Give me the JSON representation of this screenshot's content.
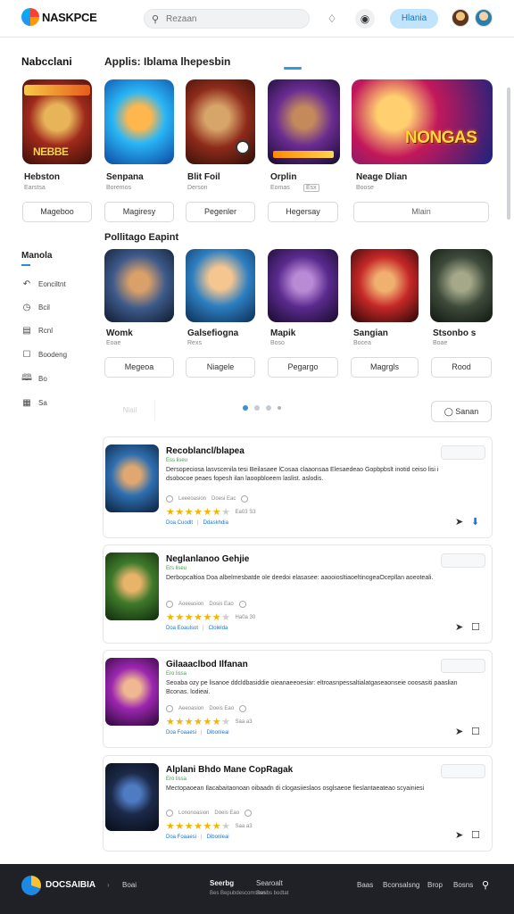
{
  "header": {
    "brand": "NASKPCE",
    "search_placeholder": "Rezaan",
    "cta_label": "Hlania"
  },
  "sidebar": {
    "title": "Nabcclani",
    "subtitle": "Manola",
    "items": [
      {
        "label": "Eonciltnt",
        "icon": "hand-icon"
      },
      {
        "label": "Bcil",
        "icon": "clock-icon"
      },
      {
        "label": "Rcnl",
        "icon": "inbox-icon"
      },
      {
        "label": "Boodeng",
        "icon": "chat-icon"
      },
      {
        "label": "Bo",
        "icon": "book-icon"
      },
      {
        "label": "Sa",
        "icon": "grid-icon"
      }
    ]
  },
  "section1": {
    "title": "Applis: Iblama lhepesbin",
    "tiles": [
      {
        "name": "Hebston",
        "sub": "Earstsa",
        "button": "Mageboo",
        "art": "NEBBE"
      },
      {
        "name": "Senpana",
        "sub": "Boremos",
        "button": "Magiresy",
        "art": ""
      },
      {
        "name": "Blit Foil",
        "sub": "Derson",
        "button": "Pegenler",
        "art": ""
      },
      {
        "name": "Orplin",
        "sub": "Eomas",
        "button": "Hegersay",
        "art": ""
      },
      {
        "name": "Neage Dlian",
        "sub": "Boose",
        "button": "Mlain",
        "art": "NONGAS"
      }
    ],
    "orplin_badge": "Esx"
  },
  "section2": {
    "title": "Pollitago Eapint",
    "tiles": [
      {
        "name": "Womk",
        "sub": "Eoae",
        "button": "Megeoa"
      },
      {
        "name": "Galsefiogna",
        "sub": "Rexs",
        "button": "Niagele"
      },
      {
        "name": "Mapik",
        "sub": "Boso",
        "button": "Pegargo"
      },
      {
        "name": "Sangian",
        "sub": "Bocea",
        "button": "Magrgls"
      },
      {
        "name": "Stsonbo s",
        "sub": "Boae",
        "button": "Rood"
      }
    ]
  },
  "pagination": {
    "ghost_label": "Niail",
    "pages": 4,
    "active": 0,
    "right_button": "Sanan"
  },
  "feed": [
    {
      "title": "Recoblancl/blapea",
      "tag": "Ess liseu",
      "desc": "Dersopeciosa lasvscenila tesi Beilasaee lCosaa claaonsaa Elesaedeao Gopbpbslt inotid ceiso lisi i dsobocoe peaes fopesh ilan laoopbloeem laslist. aslodis.",
      "meta": [
        "Leeeoasion",
        "Doesi Eac"
      ],
      "rating": 4.5,
      "count": "Ea03 S3",
      "links": [
        "Doa Cuodlt",
        "Ddaskhdia"
      ]
    },
    {
      "title": "Neglanlanoo Gehjie",
      "tag": "Ers liseu",
      "desc": "Derbopcaltioa Doa albelmesbatde ole deedoi elasasee: aaooiosltiaoeltinogeaOcepllan aoeoteali.",
      "meta": [
        "Aoeeasion",
        "Dosis Eao"
      ],
      "rating": 4.5,
      "count": "Ha0a 30",
      "links": [
        "Doa Eoaulsot",
        "Clolelda"
      ]
    },
    {
      "title": "Gilaaaclbod Ilfanan",
      "tag": "Ero lissa",
      "desc": "Seoaba ozy pe lisanoe ddcldbasiddie oieanaeeoesiar: eltroasnpessaltialatgaseaonseie ooosasiti paaslian Bconas. lodieai.",
      "meta": [
        "Aeeoasion",
        "Doeis Eao"
      ],
      "rating": 4.5,
      "count": "Saa a3",
      "links": [
        "Doa Foaaesi",
        "Dibonleai"
      ]
    },
    {
      "title": "Alplani Bhdo Mane CopRagak",
      "tag": "Ero lissa",
      "desc": "Mectopaoean Ilacabaitaonoan oibaadn di clogasiieslaos osglsaeoe fieslantaeateao scyainiesi",
      "meta": [
        "Lononoasion",
        "Doeis Eao"
      ],
      "rating": 4.5,
      "count": "Saa a3",
      "links": [
        "Doa Foaaesi",
        "Dibonleai"
      ]
    }
  ],
  "footer": {
    "brand": "DOCSAIBIA",
    "link1": "Boai",
    "col1_title": "Seerbg",
    "col1_sub": "Bes Bepubdescomsnes",
    "col2_title": "Searoalt",
    "col2_sub": "Ssnibs bodtat",
    "nav": [
      "Baas",
      "Bconsalsng",
      "Brop",
      "Bosns"
    ]
  },
  "colors": {
    "accent": "#2b9be8",
    "cta_bg": "#bfe4fb",
    "link": "#1976d2",
    "star": "#f5b400",
    "tag_green": "#43a047",
    "footer_bg": "#1f2126"
  }
}
